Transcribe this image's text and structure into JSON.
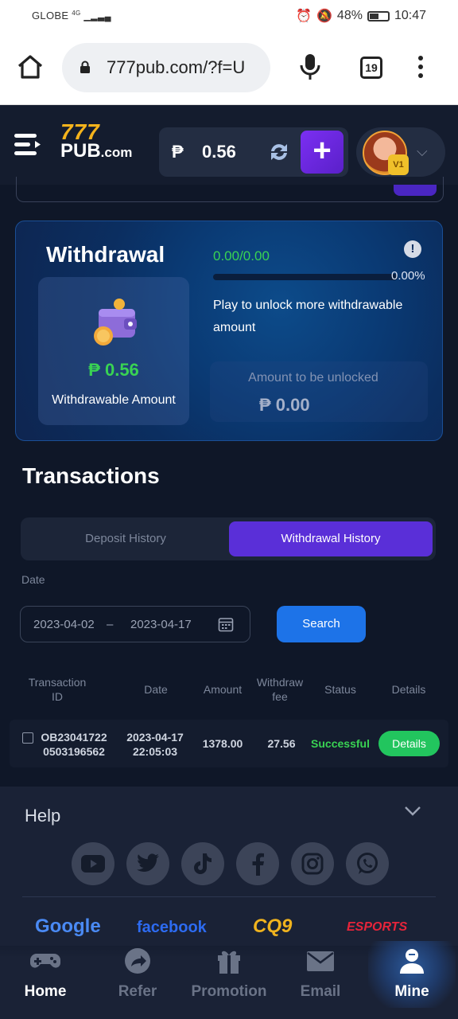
{
  "statusbar": {
    "carrier": "GLOBE",
    "network": "4G",
    "battery": "48%",
    "time": "10:47"
  },
  "browser": {
    "url": "777pub.com/?f=U",
    "tab_count": "19"
  },
  "header": {
    "logo_top": "777",
    "logo_bottom": "PUB",
    "logo_suffix": ".com",
    "currency": "₱",
    "balance": "0.56",
    "plus_label": "+",
    "vip_badge": "V1"
  },
  "withdrawal": {
    "title": "Withdrawal",
    "withdrawable_amount": "₱ 0.56",
    "withdrawable_label": "Withdrawable Amount",
    "progress_text": "0.00/0.00",
    "progress_fraction": 0.0,
    "progress_percent": "0.00%",
    "info_label": "!",
    "note": "Play to unlock more withdrawable amount",
    "to_unlock_label": "Amount to be unlocked",
    "to_unlock_value": "₱ 0.00"
  },
  "transactions": {
    "title": "Transactions",
    "tabs": [
      {
        "label": "Deposit History",
        "active": false
      },
      {
        "label": "Withdrawal History",
        "active": true
      }
    ],
    "date_label": "Date",
    "date_from": "2023-04-02",
    "date_sep": "–",
    "date_to": "2023-04-17",
    "search_label": "Search",
    "columns": [
      "Transaction ID",
      "Date",
      "Amount",
      "Withdraw fee",
      "Status",
      "Details"
    ],
    "rows": [
      {
        "id_line1": "OB23041722",
        "id_line2": "0503196562",
        "date_line1": "2023-04-17",
        "date_line2": "22:05:03",
        "amount": "1378.00",
        "fee": "27.56",
        "status": "Successful",
        "details_label": "Details"
      }
    ]
  },
  "footer": {
    "help_label": "Help",
    "socials": [
      "youtube-icon",
      "twitter-icon",
      "tiktok-icon",
      "facebook-icon",
      "instagram-icon",
      "whatsapp-icon"
    ],
    "partners": [
      "Google",
      "facebook",
      "CQ9",
      "ESPORTS"
    ]
  },
  "nav": {
    "items": [
      {
        "label": "Home",
        "icon": "gamepad-icon",
        "active": true
      },
      {
        "label": "Refer",
        "icon": "share-icon",
        "active": false
      },
      {
        "label": "Promotion",
        "icon": "gift-icon",
        "active": false
      },
      {
        "label": "Email",
        "icon": "mail-icon",
        "active": false
      },
      {
        "label": "Mine",
        "icon": "user-icon",
        "active": true
      }
    ]
  },
  "colors": {
    "accent_purple": "#5a2fd8",
    "success_green": "#39d353",
    "search_blue": "#1d73e8",
    "logo_gold": "#f5b31c"
  }
}
